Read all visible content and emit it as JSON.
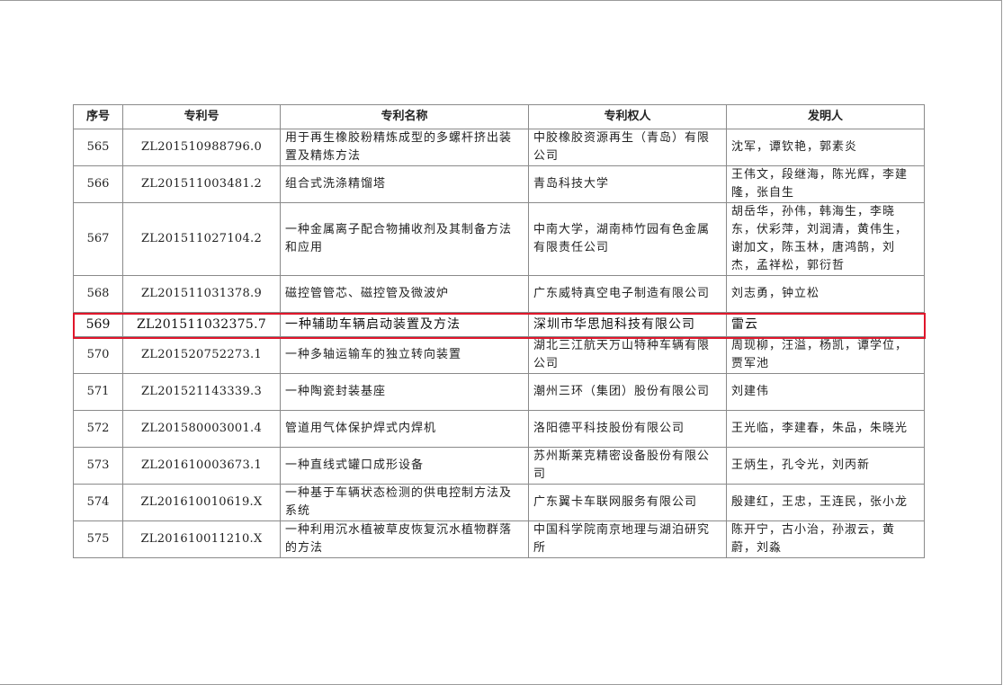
{
  "table": {
    "headers": {
      "no": "序号",
      "patent_no": "专利号",
      "name": "专利名称",
      "owner": "专利权人",
      "inventor": "发明人"
    },
    "rows": [
      {
        "no": "565",
        "patent_no": "ZL201510988796.0",
        "name": "用于再生橡胶粉精炼成型的多螺杆挤出装置及精炼方法",
        "owner": "中胶橡胶资源再生（青岛）有限公司",
        "inventor": "沈军，谭钦艳，郭素炎"
      },
      {
        "no": "566",
        "patent_no": "ZL201511003481.2",
        "name": "组合式洗涤精馏塔",
        "owner": "青岛科技大学",
        "inventor": "王伟文，段继海，陈光辉，李建隆，张自生"
      },
      {
        "no": "567",
        "patent_no": "ZL201511027104.2",
        "name": "一种金属离子配合物捕收剂及其制备方法和应用",
        "owner": "中南大学，湖南柿竹园有色金属有限责任公司",
        "inventor": "胡岳华，孙伟，韩海生，李晓东，伏彩萍，刘润清，黄伟生，谢加文，陈玉林，唐鸿鹄，刘杰，孟祥松，郭衍哲"
      },
      {
        "no": "568",
        "patent_no": "ZL201511031378.9",
        "name": "磁控管管芯、磁控管及微波炉",
        "owner": "广东威特真空电子制造有限公司",
        "inventor": "刘志勇，钟立松"
      },
      {
        "no": "569",
        "patent_no": "ZL201511032375.7",
        "name": "一种辅助车辆启动装置及方法",
        "owner": "深圳市华思旭科技有限公司",
        "inventor": "雷云"
      },
      {
        "no": "570",
        "patent_no": "ZL201520752273.1",
        "name": "一种多轴运输车的独立转向装置",
        "owner": "湖北三江航天万山特种车辆有限公司",
        "inventor": "周现柳，汪溢，杨凯，谭学位，贾军池"
      },
      {
        "no": "571",
        "patent_no": "ZL201521143339.3",
        "name": "一种陶瓷封装基座",
        "owner": "潮州三环（集团）股份有限公司",
        "inventor": "刘建伟"
      },
      {
        "no": "572",
        "patent_no": "ZL201580003001.4",
        "name": "管道用气体保护焊式内焊机",
        "owner": "洛阳德平科技股份有限公司",
        "inventor": "王光临，李建春，朱品，朱晓光"
      },
      {
        "no": "573",
        "patent_no": "ZL201610003673.1",
        "name": "一种直线式罐口成形设备",
        "owner": "苏州斯莱克精密设备股份有限公司",
        "inventor": "王炳生，孔令光，刘丙新"
      },
      {
        "no": "574",
        "patent_no": "ZL201610010619.X",
        "name": "一种基于车辆状态检测的供电控制方法及系统",
        "owner": "广东翼卡车联网服务有限公司",
        "inventor": "殷建红，王忠，王连民，张小龙"
      },
      {
        "no": "575",
        "patent_no": "ZL201610011210.X",
        "name": "一种利用沉水植被草皮恢复沉水植物群落的方法",
        "owner": "中国科学院南京地理与湖泊研究所",
        "inventor": "陈开宁，古小治，孙淑云，黄蔚，刘淼"
      }
    ]
  },
  "highlight": {
    "row_no": "569",
    "color": "#e0162b"
  }
}
